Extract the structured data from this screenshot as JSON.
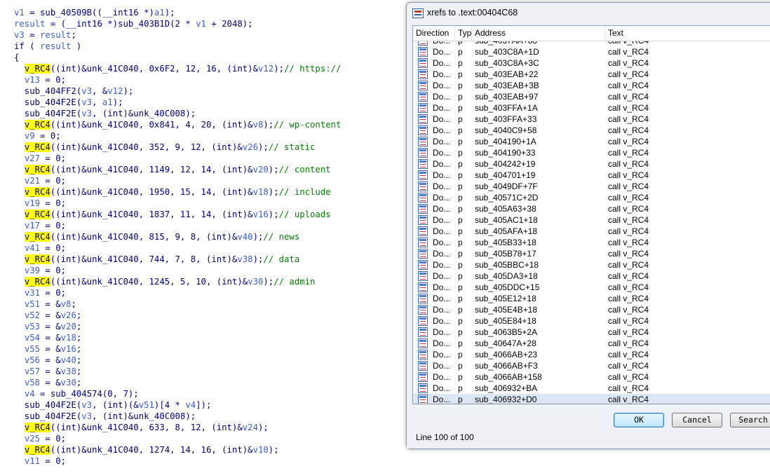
{
  "code": {
    "lines": [
      [
        [
          "v1",
          "var"
        ],
        [
          " = sub_40509B((",
          "txt"
        ],
        [
          "__int16",
          "txt"
        ],
        [
          " *)",
          "txt"
        ],
        [
          "a1",
          "var"
        ],
        [
          ");",
          "txt"
        ]
      ],
      [
        [
          "result",
          "var"
        ],
        [
          " = (__int16 *)sub_403B1D(2 * ",
          "txt"
        ],
        [
          "v1",
          "var"
        ],
        [
          " + 2048);",
          "txt"
        ]
      ],
      [
        [
          "v3",
          "var"
        ],
        [
          " = ",
          "txt"
        ],
        [
          "result",
          "var"
        ],
        [
          ";",
          "txt"
        ]
      ],
      [
        [
          "if ( ",
          "txt"
        ],
        [
          "result",
          "var"
        ],
        [
          " )",
          "txt"
        ]
      ],
      [
        [
          "{",
          "txt"
        ]
      ],
      [
        [
          "  ",
          "txt"
        ],
        [
          "v_RC4",
          "hl"
        ],
        [
          "((int)&unk_41C040, 0x6F2, 12, 16, (int)&",
          "txt"
        ],
        [
          "v12",
          "var"
        ],
        [
          ");",
          "txt"
        ],
        [
          "// https://",
          "cmt"
        ]
      ],
      [
        [
          "  ",
          "txt"
        ],
        [
          "v13",
          "var"
        ],
        [
          " = 0;",
          "txt"
        ]
      ],
      [
        [
          "  sub_404FF2(",
          "txt"
        ],
        [
          "v3",
          "var"
        ],
        [
          ", &",
          "txt"
        ],
        [
          "v12",
          "var"
        ],
        [
          ");",
          "txt"
        ]
      ],
      [
        [
          "  sub_404F2E(",
          "txt"
        ],
        [
          "v3",
          "var"
        ],
        [
          ", ",
          "txt"
        ],
        [
          "a1",
          "var"
        ],
        [
          ");",
          "txt"
        ]
      ],
      [
        [
          "  sub_404F2E(",
          "txt"
        ],
        [
          "v3",
          "var"
        ],
        [
          ", (int)&unk_40C008);",
          "txt"
        ]
      ],
      [
        [
          "  ",
          "txt"
        ],
        [
          "v_RC4",
          "hl"
        ],
        [
          "((int)&unk_41C040, 0x841, 4, 20, (int)&",
          "txt"
        ],
        [
          "v8",
          "var"
        ],
        [
          ");",
          "txt"
        ],
        [
          "// wp-content",
          "cmt"
        ]
      ],
      [
        [
          "  ",
          "txt"
        ],
        [
          "v9",
          "var"
        ],
        [
          " = 0;",
          "txt"
        ]
      ],
      [
        [
          "  ",
          "txt"
        ],
        [
          "v_RC4",
          "hl"
        ],
        [
          "((int)&unk_41C040, 352, 9, 12, (int)&",
          "txt"
        ],
        [
          "v26",
          "var"
        ],
        [
          ");",
          "txt"
        ],
        [
          "// static",
          "cmt"
        ]
      ],
      [
        [
          "  ",
          "txt"
        ],
        [
          "v27",
          "var"
        ],
        [
          " = 0;",
          "txt"
        ]
      ],
      [
        [
          "  ",
          "txt"
        ],
        [
          "v_RC4",
          "hl"
        ],
        [
          "((int)&unk_41C040, 1149, 12, 14, (int)&",
          "txt"
        ],
        [
          "v20",
          "var"
        ],
        [
          ");",
          "txt"
        ],
        [
          "// content",
          "cmt"
        ]
      ],
      [
        [
          "  ",
          "txt"
        ],
        [
          "v21",
          "var"
        ],
        [
          " = 0;",
          "txt"
        ]
      ],
      [
        [
          "  ",
          "txt"
        ],
        [
          "v_RC4",
          "hl"
        ],
        [
          "((int)&unk_41C040, 1950, 15, 14, (int)&",
          "txt"
        ],
        [
          "v18",
          "var"
        ],
        [
          ");",
          "txt"
        ],
        [
          "// include",
          "cmt"
        ]
      ],
      [
        [
          "  ",
          "txt"
        ],
        [
          "v19",
          "var"
        ],
        [
          " = 0;",
          "txt"
        ]
      ],
      [
        [
          "  ",
          "txt"
        ],
        [
          "v_RC4",
          "hl"
        ],
        [
          "((int)&unk_41C040, 1837, 11, 14, (int)&",
          "txt"
        ],
        [
          "v16",
          "var"
        ],
        [
          ");",
          "txt"
        ],
        [
          "// uploads",
          "cmt"
        ]
      ],
      [
        [
          "  ",
          "txt"
        ],
        [
          "v17",
          "var"
        ],
        [
          " = 0;",
          "txt"
        ]
      ],
      [
        [
          "  ",
          "txt"
        ],
        [
          "v_RC4",
          "hl"
        ],
        [
          "((int)&unk_41C040, 815, 9, 8, (int)&",
          "txt"
        ],
        [
          "v40",
          "var"
        ],
        [
          ");",
          "txt"
        ],
        [
          "// news",
          "cmt"
        ]
      ],
      [
        [
          "  ",
          "txt"
        ],
        [
          "v41",
          "var"
        ],
        [
          " = 0;",
          "txt"
        ]
      ],
      [
        [
          "  ",
          "txt"
        ],
        [
          "v_RC4",
          "hl"
        ],
        [
          "((int)&unk_41C040, 744, 7, 8, (int)&",
          "txt"
        ],
        [
          "v38",
          "var"
        ],
        [
          ");",
          "txt"
        ],
        [
          "// data",
          "cmt"
        ]
      ],
      [
        [
          "  ",
          "txt"
        ],
        [
          "v39",
          "var"
        ],
        [
          " = 0;",
          "txt"
        ]
      ],
      [
        [
          "  ",
          "txt"
        ],
        [
          "v_RC4",
          "hl"
        ],
        [
          "((int)&unk_41C040, 1245, 5, 10, (int)&",
          "txt"
        ],
        [
          "v30",
          "var"
        ],
        [
          ");",
          "txt"
        ],
        [
          "// admin",
          "cmt"
        ]
      ],
      [
        [
          "  ",
          "txt"
        ],
        [
          "v31",
          "var"
        ],
        [
          " = 0;",
          "txt"
        ]
      ],
      [
        [
          "  ",
          "txt"
        ],
        [
          "v51",
          "var"
        ],
        [
          " = &",
          "txt"
        ],
        [
          "v8",
          "var"
        ],
        [
          ";",
          "txt"
        ]
      ],
      [
        [
          "  ",
          "txt"
        ],
        [
          "v52",
          "var"
        ],
        [
          " = &",
          "txt"
        ],
        [
          "v26",
          "var"
        ],
        [
          ";",
          "txt"
        ]
      ],
      [
        [
          "  ",
          "txt"
        ],
        [
          "v53",
          "var"
        ],
        [
          " = &",
          "txt"
        ],
        [
          "v20",
          "var"
        ],
        [
          ";",
          "txt"
        ]
      ],
      [
        [
          "  ",
          "txt"
        ],
        [
          "v54",
          "var"
        ],
        [
          " = &",
          "txt"
        ],
        [
          "v18",
          "var"
        ],
        [
          ";",
          "txt"
        ]
      ],
      [
        [
          "  ",
          "txt"
        ],
        [
          "v55",
          "var"
        ],
        [
          " = &",
          "txt"
        ],
        [
          "v16",
          "var"
        ],
        [
          ";",
          "txt"
        ]
      ],
      [
        [
          "  ",
          "txt"
        ],
        [
          "v56",
          "var"
        ],
        [
          " = &",
          "txt"
        ],
        [
          "v40",
          "var"
        ],
        [
          ";",
          "txt"
        ]
      ],
      [
        [
          "  ",
          "txt"
        ],
        [
          "v57",
          "var"
        ],
        [
          " = &",
          "txt"
        ],
        [
          "v38",
          "var"
        ],
        [
          ";",
          "txt"
        ]
      ],
      [
        [
          "  ",
          "txt"
        ],
        [
          "v58",
          "var"
        ],
        [
          " = &",
          "txt"
        ],
        [
          "v30",
          "var"
        ],
        [
          ";",
          "txt"
        ]
      ],
      [
        [
          "  ",
          "txt"
        ],
        [
          "v4",
          "var"
        ],
        [
          " = sub_404574(0, 7);",
          "txt"
        ]
      ],
      [
        [
          "  sub_404F2E(",
          "txt"
        ],
        [
          "v3",
          "var"
        ],
        [
          ", (int)(&",
          "txt"
        ],
        [
          "v51",
          "var"
        ],
        [
          ")[4 * ",
          "txt"
        ],
        [
          "v4",
          "var"
        ],
        [
          "]);",
          "txt"
        ]
      ],
      [
        [
          "  sub_404F2E(",
          "txt"
        ],
        [
          "v3",
          "var"
        ],
        [
          ", (int)&unk_40C008);",
          "txt"
        ]
      ],
      [
        [
          "  ",
          "txt"
        ],
        [
          "v_RC4",
          "hl"
        ],
        [
          "((int)&unk_41C040, 633, 8, 12, (int)&",
          "txt"
        ],
        [
          "v24",
          "var"
        ],
        [
          ");",
          "txt"
        ]
      ],
      [
        [
          "  ",
          "txt"
        ],
        [
          "v25",
          "var"
        ],
        [
          " = 0;",
          "txt"
        ]
      ],
      [
        [
          "  ",
          "txt"
        ],
        [
          "v_RC4",
          "hl"
        ],
        [
          "((int)&unk_41C040, 1274, 14, 16, (int)&",
          "txt"
        ],
        [
          "v10",
          "var"
        ],
        [
          ");",
          "txt"
        ]
      ],
      [
        [
          "  ",
          "txt"
        ],
        [
          "v11",
          "var"
        ],
        [
          " = 0;",
          "txt"
        ]
      ]
    ]
  },
  "dialog": {
    "title": "xrefs to .text:00404C68",
    "columns": {
      "direction": "Direction",
      "type": "Typ",
      "address": "Address",
      "text": "Text"
    },
    "partial_row": {
      "direction": "Do...",
      "type": "p",
      "address": "sub_4037AA+88",
      "text": "call    v_RC4"
    },
    "rows": [
      {
        "direction": "Do...",
        "type": "p",
        "address": "sub_403C8A+1D",
        "text": "call    v_RC4"
      },
      {
        "direction": "Do...",
        "type": "p",
        "address": "sub_403C8A+3C",
        "text": "call    v_RC4"
      },
      {
        "direction": "Do...",
        "type": "p",
        "address": "sub_403EAB+22",
        "text": "call    v_RC4"
      },
      {
        "direction": "Do...",
        "type": "p",
        "address": "sub_403EAB+3B",
        "text": "call    v_RC4"
      },
      {
        "direction": "Do...",
        "type": "p",
        "address": "sub_403EAB+97",
        "text": "call    v_RC4"
      },
      {
        "direction": "Do...",
        "type": "p",
        "address": "sub_403FFA+1A",
        "text": "call    v_RC4"
      },
      {
        "direction": "Do...",
        "type": "p",
        "address": "sub_403FFA+33",
        "text": "call    v_RC4"
      },
      {
        "direction": "Do...",
        "type": "p",
        "address": "sub_4040C9+58",
        "text": "call    v_RC4"
      },
      {
        "direction": "Do...",
        "type": "p",
        "address": "sub_404190+1A",
        "text": "call    v_RC4"
      },
      {
        "direction": "Do...",
        "type": "p",
        "address": "sub_404190+33",
        "text": "call    v_RC4"
      },
      {
        "direction": "Do...",
        "type": "p",
        "address": "sub_404242+19",
        "text": "call    v_RC4"
      },
      {
        "direction": "Do...",
        "type": "p",
        "address": "sub_404701+19",
        "text": "call    v_RC4"
      },
      {
        "direction": "Do...",
        "type": "p",
        "address": "sub_4049DF+7F",
        "text": "call    v_RC4"
      },
      {
        "direction": "Do...",
        "type": "p",
        "address": "sub_40571C+2D",
        "text": "call    v_RC4"
      },
      {
        "direction": "Do...",
        "type": "p",
        "address": "sub_405A63+38",
        "text": "call    v_RC4"
      },
      {
        "direction": "Do...",
        "type": "p",
        "address": "sub_405AC1+18",
        "text": "call    v_RC4"
      },
      {
        "direction": "Do...",
        "type": "p",
        "address": "sub_405AFA+18",
        "text": "call    v_RC4"
      },
      {
        "direction": "Do...",
        "type": "p",
        "address": "sub_405B33+18",
        "text": "call    v_RC4"
      },
      {
        "direction": "Do...",
        "type": "p",
        "address": "sub_405B78+17",
        "text": "call    v_RC4"
      },
      {
        "direction": "Do...",
        "type": "p",
        "address": "sub_405BBC+18",
        "text": "call    v_RC4"
      },
      {
        "direction": "Do...",
        "type": "p",
        "address": "sub_405DA3+18",
        "text": "call    v_RC4"
      },
      {
        "direction": "Do...",
        "type": "p",
        "address": "sub_405DDC+15",
        "text": "call    v_RC4"
      },
      {
        "direction": "Do...",
        "type": "p",
        "address": "sub_405E12+18",
        "text": "call    v_RC4"
      },
      {
        "direction": "Do...",
        "type": "p",
        "address": "sub_405E4B+18",
        "text": "call    v_RC4"
      },
      {
        "direction": "Do...",
        "type": "p",
        "address": "sub_405E84+18",
        "text": "call    v_RC4"
      },
      {
        "direction": "Do...",
        "type": "p",
        "address": "sub_4063B5+2A",
        "text": "call    v_RC4"
      },
      {
        "direction": "Do...",
        "type": "p",
        "address": "sub_40647A+28",
        "text": "call    v_RC4"
      },
      {
        "direction": "Do...",
        "type": "p",
        "address": "sub_4066AB+23",
        "text": "call    v_RC4"
      },
      {
        "direction": "Do...",
        "type": "p",
        "address": "sub_4066AB+F3",
        "text": "call    v_RC4"
      },
      {
        "direction": "Do...",
        "type": "p",
        "address": "sub_4066AB+158",
        "text": "call    v_RC4"
      },
      {
        "direction": "Do...",
        "type": "p",
        "address": "sub_406932+BA",
        "text": "call    v_RC4"
      },
      {
        "direction": "Do...",
        "type": "p",
        "address": "sub_406932+D0",
        "text": "call    v_RC4",
        "selected": true
      }
    ],
    "buttons": {
      "ok": "OK",
      "cancel": "Cancel",
      "search": "Search"
    },
    "status": "Line 100 of 100"
  }
}
